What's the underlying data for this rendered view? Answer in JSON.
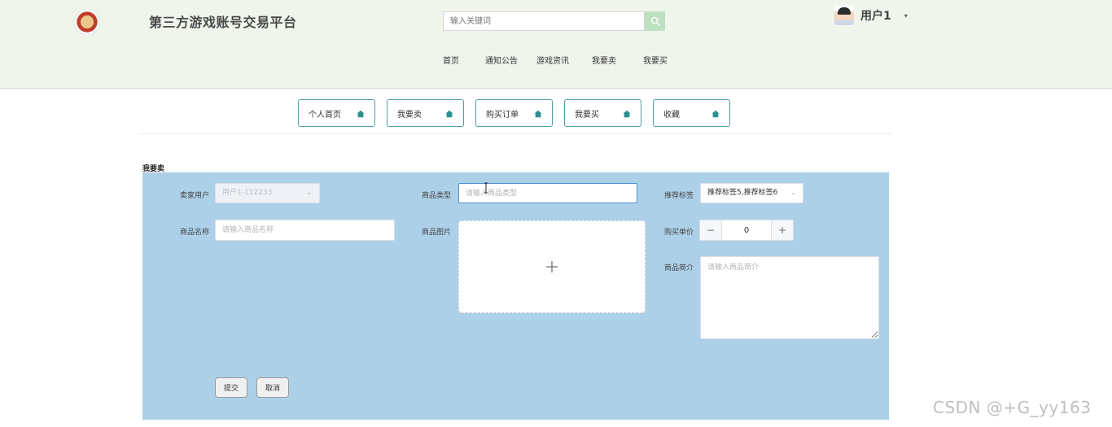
{
  "header": {
    "site_title": "第三方游戏账号交易平台",
    "search": {
      "placeholder": "输入关键词",
      "value": ""
    },
    "user": {
      "name": "用户1"
    }
  },
  "nav": [
    {
      "label": "首页"
    },
    {
      "label": "通知公告"
    },
    {
      "label": "游戏资讯"
    },
    {
      "label": "我要卖"
    },
    {
      "label": "我要买"
    }
  ],
  "tabs": [
    {
      "label": "个人首页"
    },
    {
      "label": "我要卖"
    },
    {
      "label": "购买订单"
    },
    {
      "label": "我要买"
    },
    {
      "label": "收藏"
    }
  ],
  "form": {
    "section_title": "我要卖",
    "seller": {
      "label": "卖家用户",
      "value": "用户1-112233"
    },
    "category": {
      "label": "商品类型",
      "placeholder": "请输入商品类型"
    },
    "tags": {
      "label": "推荐标签",
      "value": "推荐标签5,推荐标签6"
    },
    "name": {
      "label": "商品名称",
      "placeholder": "请输入商品名称"
    },
    "image": {
      "label": "商品图片"
    },
    "price": {
      "label": "购买单价",
      "value": "0"
    },
    "intro": {
      "label": "商品简介",
      "placeholder": "请输入商品简介"
    },
    "submit_label": "提交",
    "cancel_label": "取消"
  },
  "watermark": "CSDN @+G_yy163",
  "colors": {
    "header_bg": "#f0f5ec",
    "panel_bg": "#acd0e8",
    "tab_border": "#4fa0a0",
    "search_btn": "#bde0c0"
  }
}
